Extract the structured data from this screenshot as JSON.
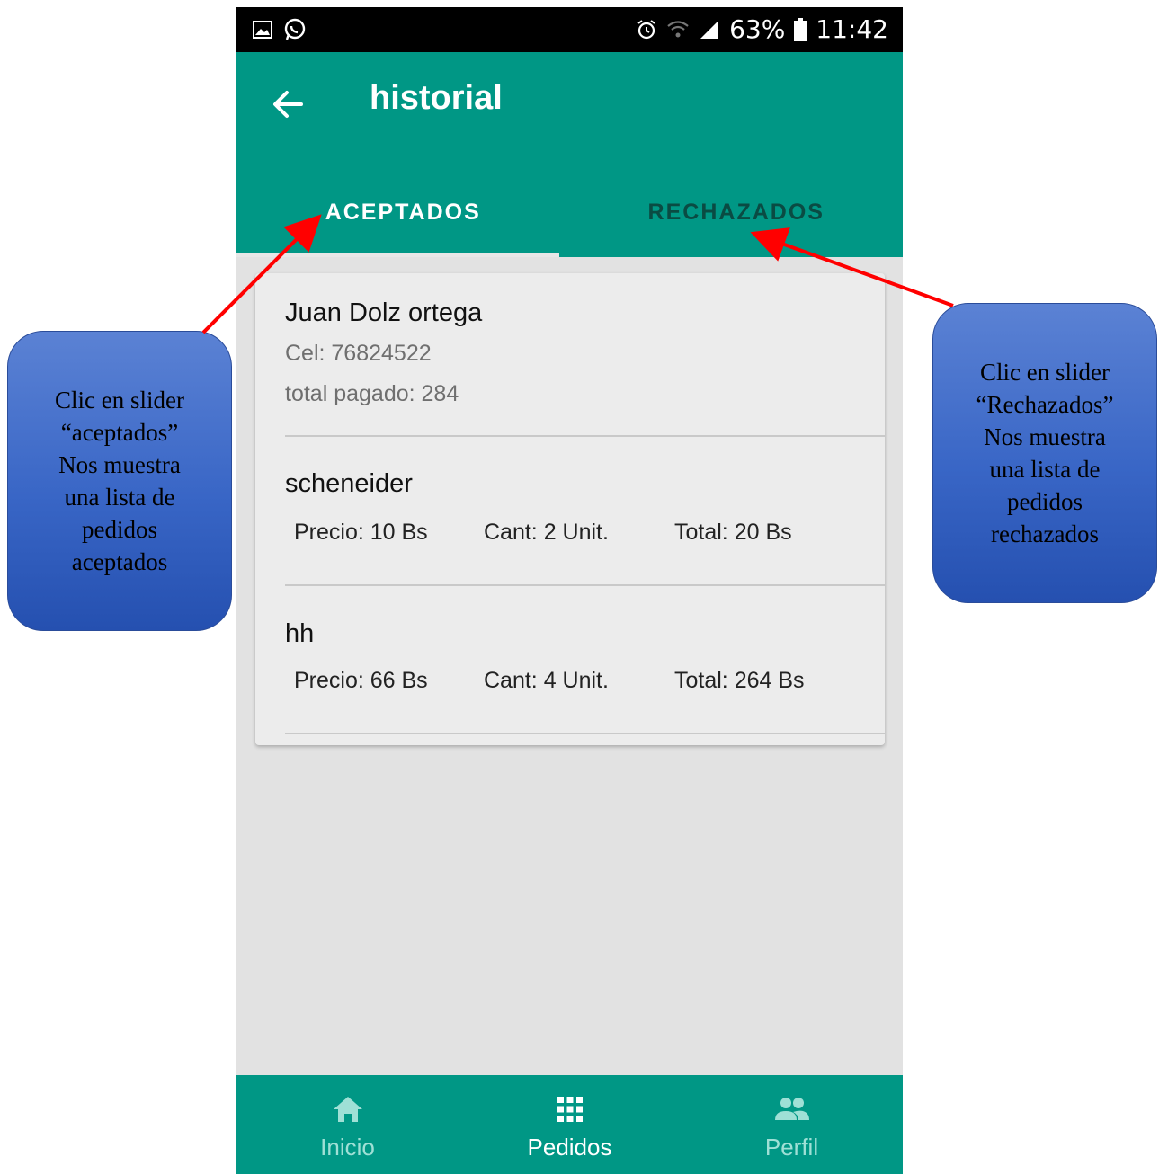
{
  "status_bar": {
    "battery": "63%",
    "time": "11:42"
  },
  "appbar": {
    "title": "historial"
  },
  "tabs": [
    {
      "label": "ACEPTADOS",
      "active": true
    },
    {
      "label": "RECHAZADOS",
      "active": false
    }
  ],
  "order": {
    "customer_name": "Juan Dolz ortega",
    "phone": "Cel: 76824522",
    "total_paid": "total pagado: 284",
    "items": [
      {
        "name": "scheneider",
        "price": "Precio: 10 Bs",
        "qty": "Cant: 2 Unit.",
        "total": "Total: 20 Bs"
      },
      {
        "name": "hh",
        "price": "Precio: 66 Bs",
        "qty": "Cant: 4 Unit.",
        "total": "Total: 264 Bs"
      }
    ]
  },
  "bottom_nav": [
    {
      "label": "Inicio",
      "icon": "home-icon",
      "active": false
    },
    {
      "label": "Pedidos",
      "icon": "grid-icon",
      "active": true
    },
    {
      "label": "Perfil",
      "icon": "people-icon",
      "active": false
    }
  ],
  "annotations": {
    "left_callout": "Clic en slider\n“aceptados”\nNos muestra\nuna lista de\npedidos\naceptados",
    "right_callout": "Clic en slider\n“Rechazados”\nNos muestra\nuna lista de\npedidos\nrechazados"
  },
  "colors": {
    "primary": "#009785",
    "background": "#e2e2e2",
    "callout": "#3966c6",
    "arrow": "#ff0000"
  }
}
